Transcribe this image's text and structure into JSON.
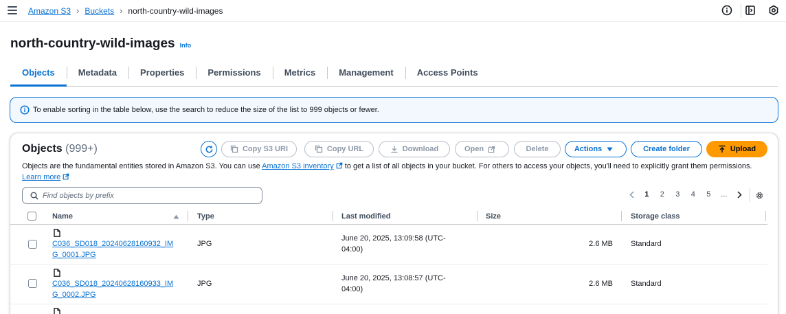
{
  "breadcrumb": {
    "items": [
      "Amazon S3",
      "Buckets"
    ],
    "current": "north-country-wild-images"
  },
  "header": {
    "title": "north-country-wild-images",
    "info_label": "Info"
  },
  "tabs": [
    {
      "label": "Objects",
      "active": true
    },
    {
      "label": "Metadata"
    },
    {
      "label": "Properties"
    },
    {
      "label": "Permissions"
    },
    {
      "label": "Metrics"
    },
    {
      "label": "Management"
    },
    {
      "label": "Access Points"
    }
  ],
  "alert": {
    "text": "To enable sorting in the table below, use the search to reduce the size of the list to 999 objects or fewer."
  },
  "objects": {
    "title": "Objects",
    "count": "(999+)",
    "desc_part1": "Objects are the fundamental entities stored in Amazon S3. You can use ",
    "desc_link1": "Amazon S3 inventory",
    "desc_part2": " to get a list of all objects in your bucket. For others to access your objects, you'll need to explicitly grant them permissions. ",
    "desc_link2": "Learn more",
    "buttons": {
      "copy_s3_uri": "Copy S3 URI",
      "copy_url": "Copy URL",
      "download": "Download",
      "open": "Open",
      "delete": "Delete",
      "actions": "Actions",
      "create_folder": "Create folder",
      "upload": "Upload"
    },
    "search_placeholder": "Find objects by prefix",
    "pagination": {
      "pages": [
        "1",
        "2",
        "3",
        "4",
        "5",
        "..."
      ],
      "current": "1"
    },
    "columns": [
      "Name",
      "Type",
      "Last modified",
      "Size",
      "Storage class"
    ],
    "rows": [
      {
        "name_line1": "C036_SD018_20240628160932_IM",
        "name_line2": "G_0001.JPG",
        "type": "JPG",
        "modified_line1": "June 20, 2025, 13:09:58 (UTC-",
        "modified_line2": "04:00)",
        "size": "2.6 MB",
        "storage": "Standard"
      },
      {
        "name_line1": "C036_SD018_20240628160933_IM",
        "name_line2": "G_0002.JPG",
        "type": "JPG",
        "modified_line1": "June 20, 2025, 13:08:57 (UTC-",
        "modified_line2": "04:00)",
        "size": "2.6 MB",
        "storage": "Standard"
      }
    ]
  },
  "colors": {
    "link": "#0972d3",
    "primary_button": "#ff9900",
    "alert_bg": "#f2f8fd"
  }
}
